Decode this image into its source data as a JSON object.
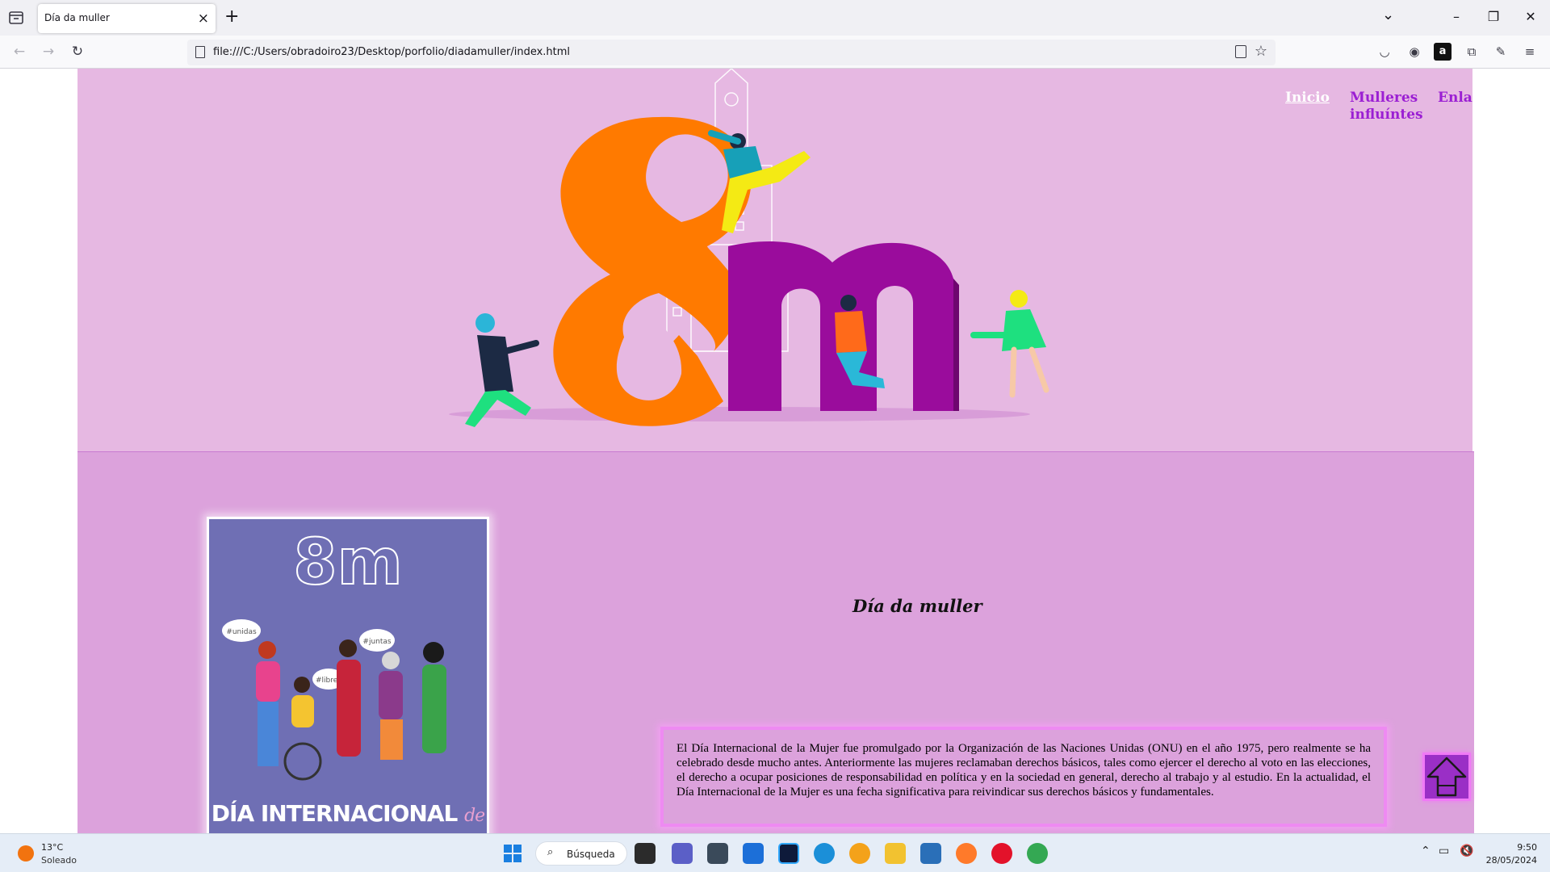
{
  "browser": {
    "tab_title": "Día da muller",
    "tab_close": "×",
    "new_tab": "+",
    "url": "file:///C:/Users/obradoiro23/Desktop/porfolio/diadamuller/index.html"
  },
  "site": {
    "nav": [
      {
        "label": "Inicio",
        "active": true
      },
      {
        "label": "Mulleres influíntes",
        "active": false
      },
      {
        "label": "Enlaces",
        "active": false
      }
    ],
    "section_title": "Día da muller",
    "paragraph": "El Día Internacional de la Mujer fue promulgado por la Organización de las Naciones Unidas (ONU) en el año 1975, pero realmente se ha celebrado desde mucho antes. Anteriormente las mujeres reclamaban derechos básicos, tales como ejercer el derecho al voto en las elecciones, el derecho a ocupar posiciones de responsabilidad en política y en la sociedad en general, derecho al trabajo y al estudio. En la actualidad, el Día Internacional de la Mujer es una fecha significativa para reivindicar sus derechos básicos y fundamentales.",
    "poster": {
      "headline": "8m",
      "bubbles": [
        "#unidas",
        "#juntas",
        "#libres"
      ],
      "caption_main": "DÍA INTERNACIONAL",
      "caption_small": "de las"
    },
    "hero_text": "8m",
    "colors": {
      "header_bg": "#e6b8e2",
      "main_bg": "#dca2dc",
      "nav_link": "#9b1fd3",
      "eight": "#ff7a00",
      "m_letter": "#9a0c9c",
      "box_border": "#ee8af2"
    },
    "back_to_top_icon": "arrow-up-icon"
  },
  "taskbar": {
    "weather_temp": "13°C",
    "weather_desc": "Soleado",
    "search_label": "Búsqueda",
    "time": "9:50",
    "date": "28/05/2024"
  }
}
